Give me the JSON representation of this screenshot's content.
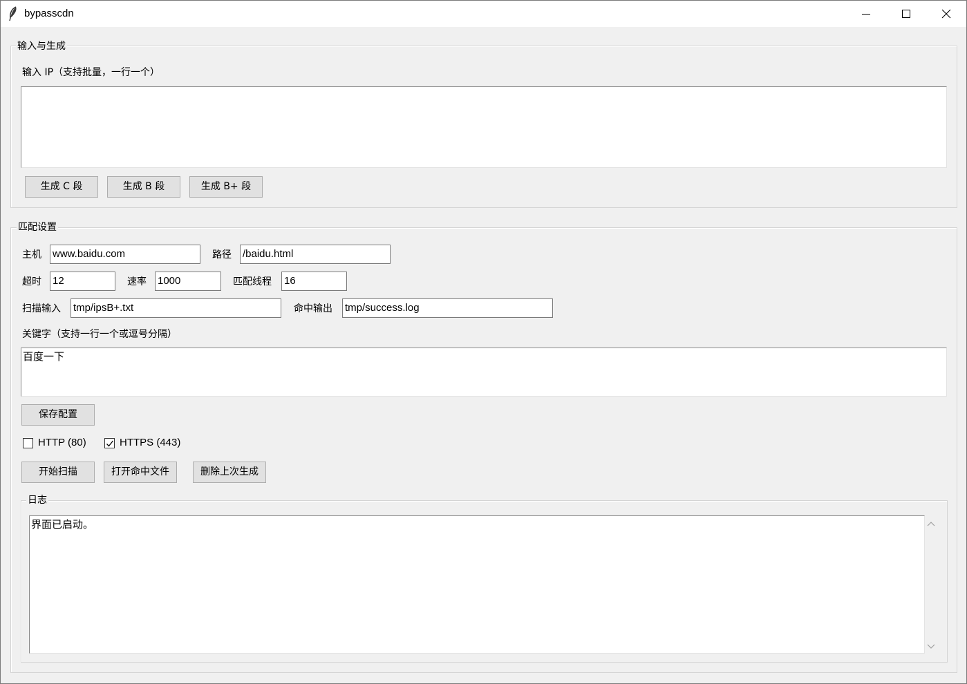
{
  "window": {
    "title": "bypasscdn",
    "icon": "feather-icon",
    "controls": [
      "minimize-icon",
      "maximize-icon",
      "close-icon"
    ]
  },
  "input_group": {
    "title": "输入与生成",
    "ip_label": "输入 IP（支持批量，一行一个）",
    "ip_value": "",
    "buttons": {
      "gen_c": "生成 C 段",
      "gen_b": "生成 B 段",
      "gen_bplus": "生成 B+ 段"
    }
  },
  "match_group": {
    "title": "匹配设置",
    "host_label": "主机",
    "host_value": "www.baidu.com",
    "path_label": "路径",
    "path_value": "/baidu.html",
    "timeout_label": "超时",
    "timeout_value": "12",
    "rate_label": "速率",
    "rate_value": "1000",
    "threads_label": "匹配线程",
    "threads_value": "16",
    "scan_input_label": "扫描输入",
    "scan_input_value": "tmp/ipsB+.txt",
    "hit_output_label": "命中输出",
    "hit_output_value": "tmp/success.log",
    "keyword_label": "关键字（支持一行一个或逗号分隔）",
    "keyword_value": "百度一下",
    "save_button": "保存配置",
    "http_label": "HTTP (80)",
    "http_checked": false,
    "https_label": "HTTPS (443)",
    "https_checked": true,
    "start_button": "开始扫描",
    "open_hits_button": "打开命中文件",
    "delete_last_button": "删除上次生成"
  },
  "log_group": {
    "title": "日志",
    "content": "界面已启动。"
  }
}
